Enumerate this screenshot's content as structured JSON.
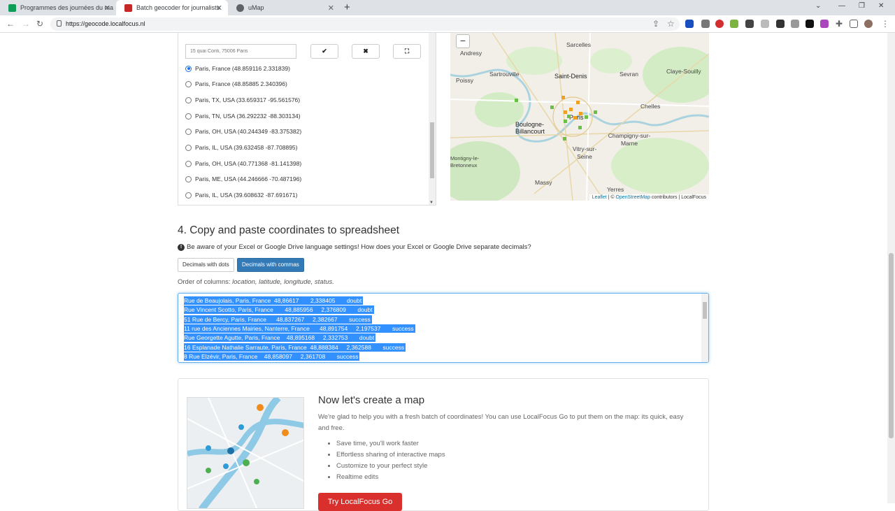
{
  "browser": {
    "tabs": [
      {
        "title": "Programmes des journées du ma",
        "icon_color": "#0f9d58"
      },
      {
        "title": "Batch geocoder for journalists",
        "icon_color": "#c62828"
      },
      {
        "title": "uMap",
        "icon_color": "#5f6368"
      }
    ],
    "url": "https://geocode.localfocus.nl"
  },
  "geocoder": {
    "address_placeholder": "15 quai Conti, 75006 Paris",
    "accept_icon": "✔",
    "reject_icon": "✖",
    "fullscreen_icon": "⛶",
    "options": [
      "Paris, France (48.859116 2.331839)",
      "Paris, France (48.85885 2.340396)",
      "Paris, TX, USA (33.659317 -95.561576)",
      "Paris, TN, USA (36.292232 -88.303134)",
      "Paris, OH, USA (40.244349 -83.375382)",
      "Paris, IL, USA (39.632458 -87.708895)",
      "Paris, OH, USA (40.771368 -81.141398)",
      "Paris, ME, USA (44.246666 -70.487196)",
      "Paris, IL, USA (39.608632 -87.691671)"
    ]
  },
  "map": {
    "zoom_out": "−",
    "places": [
      "Andresy",
      "Sarcelles",
      "Sartrouville",
      "Saint-Denis",
      "Sevran",
      "Claye-Souilly",
      "Poissy",
      "Chelles",
      "Boulogne-Billancourt",
      "Paris",
      "Champigny-sur-Marne",
      "Vitry-sur-Seine",
      "Montigny-le-Bretonneux",
      "Massy",
      "Yerres"
    ],
    "attribution_leaflet": "Leaflet",
    "attribution_sep": "| ©",
    "attribution_osm": "OpenStreetMap",
    "attribution_rest": "contributors | LocalFocus",
    "colors": {
      "success": "#6abf45",
      "doubt": "#f0a020"
    }
  },
  "section4": {
    "title": "4. Copy and paste coordinates to spreadsheet",
    "warning": "Be aware of your Excel or Google Drive language settings! How does your Excel or Google Drive separate decimals?",
    "btn_dots": "Decimals with dots",
    "btn_commas": "Decimals with commas",
    "order_prefix": "Order of columns:",
    "order_cols": "location, latitude, longitude, status.",
    "output_lines": [
      "Rue de Beaujolais, Paris, France  48,86617       2,338405       doubt",
      "Rue Vincent Scotto, Paris, France       48,885956     2,376809       doubt",
      "51 Rue de Bercy, Paris, France      48,837267     2,382667       success",
      "11 rue des Anciennes Mairies, Nanterre, France      48,891754     2,197537       success",
      "Rue Georgette Agutte, Paris, France    48,895168     2,332753       doubt",
      "16 Esplanade Nathalie Sarraute, Paris, France  48,888384     2,362588       success",
      "8 Rue Elzévir, Paris, France    48,858097     2,361708       success"
    ]
  },
  "promo": {
    "title": "Now let's create a map",
    "text": "We're glad to help you with a fresh batch of coordinates! You can use LocalFocus Go to put them on the map: its quick, easy and free.",
    "bullets": [
      "Save time, you'll work faster",
      "Effortless sharing of interactive maps",
      "Customize to your perfect style",
      "Realtime edits"
    ],
    "cta": "Try LocalFocus Go"
  }
}
